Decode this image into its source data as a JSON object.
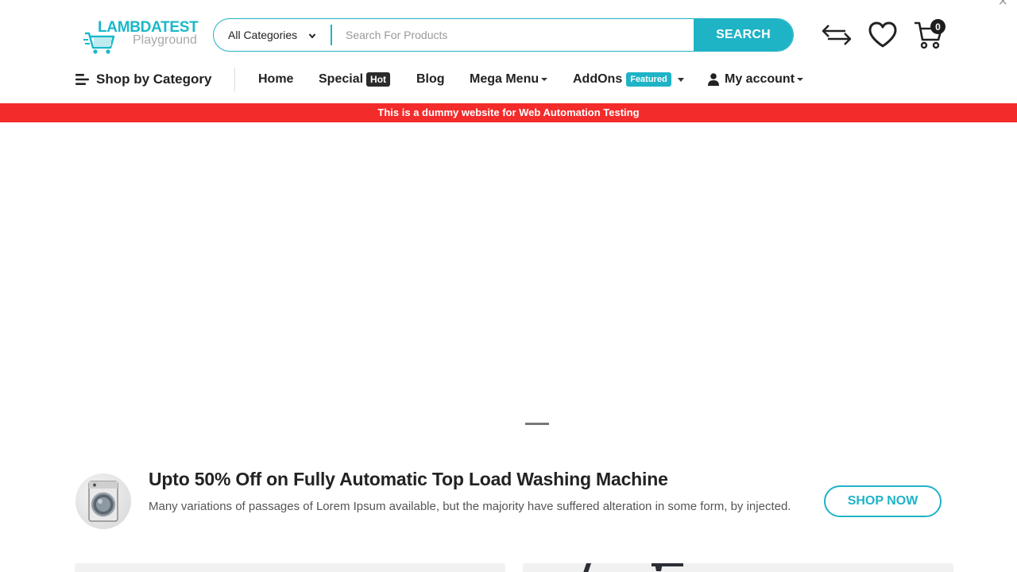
{
  "logo": {
    "brand": "LAMBDATEST",
    "sub": "Playground"
  },
  "search": {
    "category": "All Categories",
    "placeholder": "Search For Products",
    "button": "SEARCH"
  },
  "header_icons": {
    "cart_count": "0"
  },
  "nav": {
    "shop_by_category": "Shop by Category",
    "home": "Home",
    "special": "Special",
    "special_badge": "Hot",
    "blog": "Blog",
    "mega_menu": "Mega Menu",
    "addons": "AddOns",
    "addons_badge": "Featured",
    "my_account": "My account"
  },
  "notice": "This is a dummy website for Web Automation Testing",
  "promo": {
    "title": "Upto 50% Off on Fully Automatic Top Load Washing Machine",
    "description": "Many variations of passages of Lorem Ipsum available, but the majority have suffered alteration in some form, by injected.",
    "button": "SHOP NOW"
  },
  "colors": {
    "accent": "#1fb3c6",
    "notice_bg": "#f42b2b",
    "text_dark": "#222222"
  }
}
